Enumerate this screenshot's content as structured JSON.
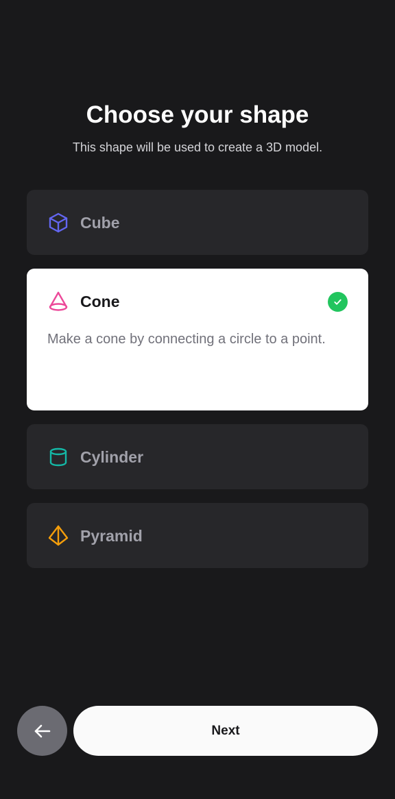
{
  "header": {
    "title": "Choose your shape",
    "subtitle": "This shape will be used to create a 3D model."
  },
  "options": [
    {
      "label": "Cube",
      "icon": "cube-icon",
      "color": "#6366f1",
      "selected": false
    },
    {
      "label": "Cone",
      "icon": "cone-icon",
      "color": "#ec4899",
      "selected": true,
      "description": "Make a cone by connecting a circle to a point."
    },
    {
      "label": "Cylinder",
      "icon": "cylinder-icon",
      "color": "#14b8a6",
      "selected": false
    },
    {
      "label": "Pyramid",
      "icon": "pyramid-icon",
      "color": "#f59e0b",
      "selected": false
    }
  ],
  "selected_indicator": {
    "icon": "check-icon",
    "color": "#22c55e"
  },
  "footer": {
    "back_icon": "arrow-left-icon",
    "next_label": "Next"
  }
}
